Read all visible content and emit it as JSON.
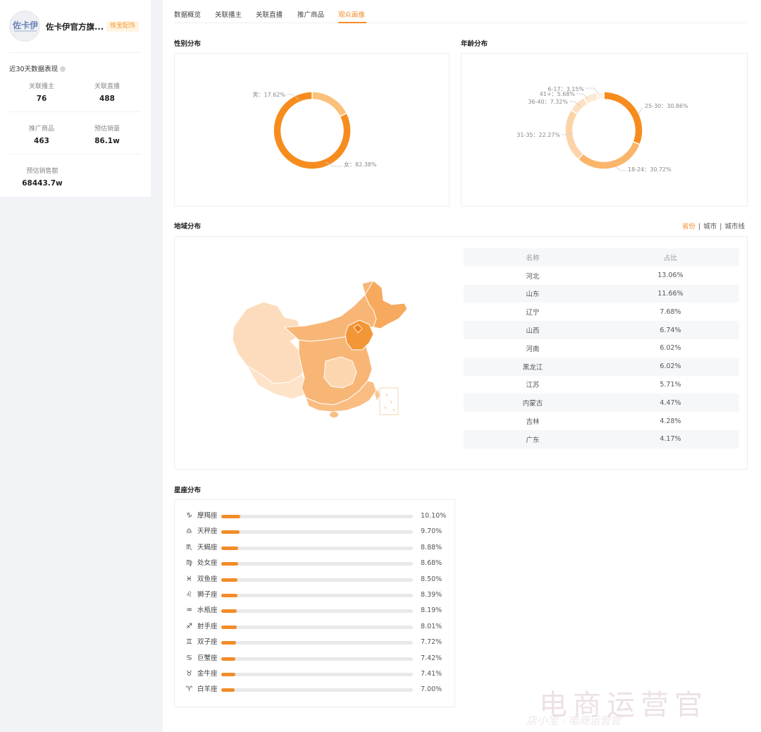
{
  "profile": {
    "avatar_text": "佐卡伊",
    "shop_name": "佐卡伊官方旗...",
    "tag": "珠宝配饰",
    "stats_title": "近30天数据表现",
    "stats": [
      {
        "label": "关联播主",
        "value": "76"
      },
      {
        "label": "关联直播",
        "value": "488"
      },
      {
        "label": "推广商品",
        "value": "463"
      },
      {
        "label": "预估销量",
        "value": "86.1w"
      },
      {
        "label": "预估销售额",
        "value": "68443.7w"
      }
    ]
  },
  "tabs": [
    {
      "label": "数据概览"
    },
    {
      "label": "关联播主"
    },
    {
      "label": "关联直播"
    },
    {
      "label": "推广商品"
    },
    {
      "label": "观众画像",
      "active": true
    }
  ],
  "gender": {
    "title": "性别分布",
    "slices": [
      {
        "label": "男：17.62%",
        "value": 17.62,
        "color": "#fbc07a"
      },
      {
        "label": "女：82.38%",
        "value": 82.38,
        "color": "#f78c1e"
      }
    ]
  },
  "age": {
    "title": "年龄分布",
    "slices": [
      {
        "label": "25-30：30.86%",
        "value": 30.86,
        "color": "#f78c1e"
      },
      {
        "label": "18-24：30.72%",
        "value": 30.72,
        "color": "#fbb56a"
      },
      {
        "label": "31-35：22.27%",
        "value": 22.27,
        "color": "#fcd4a8"
      },
      {
        "label": "36-40：7.32%",
        "value": 7.32,
        "color": "#fde0c0"
      },
      {
        "label": "41+：5.68%",
        "value": 5.68,
        "color": "#feead4"
      },
      {
        "label": "6-17：3.15%",
        "value": 3.15,
        "color": "#fef3e6"
      }
    ]
  },
  "region": {
    "title": "地域分布",
    "toggle": [
      {
        "label": "省份",
        "active": true
      },
      {
        "label": "城市"
      },
      {
        "label": "城市线"
      }
    ],
    "columns": [
      "名称",
      "占比"
    ],
    "rows": [
      {
        "name": "河北",
        "pct": "13.06%"
      },
      {
        "name": "山东",
        "pct": "11.66%"
      },
      {
        "name": "辽宁",
        "pct": "7.68%"
      },
      {
        "name": "山西",
        "pct": "6.74%"
      },
      {
        "name": "河南",
        "pct": "6.02%"
      },
      {
        "name": "黑龙江",
        "pct": "6.02%"
      },
      {
        "name": "江苏",
        "pct": "5.71%"
      },
      {
        "name": "内蒙古",
        "pct": "4.47%"
      },
      {
        "name": "吉林",
        "pct": "4.28%"
      },
      {
        "name": "广东",
        "pct": "4.17%"
      }
    ]
  },
  "zodiac": {
    "title": "星座分布",
    "items": [
      {
        "icon": "♑",
        "name": "摩羯座",
        "value": 10.1,
        "label": "10.10%"
      },
      {
        "icon": "♎",
        "name": "天秤座",
        "value": 9.7,
        "label": "9.70%"
      },
      {
        "icon": "♏",
        "name": "天蝎座",
        "value": 8.88,
        "label": "8.88%"
      },
      {
        "icon": "♍",
        "name": "处女座",
        "value": 8.68,
        "label": "8.68%"
      },
      {
        "icon": "♓",
        "name": "双鱼座",
        "value": 8.5,
        "label": "8.50%"
      },
      {
        "icon": "♌",
        "name": "狮子座",
        "value": 8.39,
        "label": "8.39%"
      },
      {
        "icon": "♒",
        "name": "水瓶座",
        "value": 8.19,
        "label": "8.19%"
      },
      {
        "icon": "♐",
        "name": "射手座",
        "value": 8.01,
        "label": "8.01%"
      },
      {
        "icon": "♊",
        "name": "双子座",
        "value": 7.72,
        "label": "7.72%"
      },
      {
        "icon": "♋",
        "name": "巨蟹座",
        "value": 7.42,
        "label": "7.42%"
      },
      {
        "icon": "♉",
        "name": "金牛座",
        "value": 7.41,
        "label": "7.41%"
      },
      {
        "icon": "♈",
        "name": "白羊座",
        "value": 7.0,
        "label": "7.00%"
      }
    ]
  },
  "watermark": {
    "big": "电商运营官",
    "small": "店小宝 · 电商运营官"
  }
}
